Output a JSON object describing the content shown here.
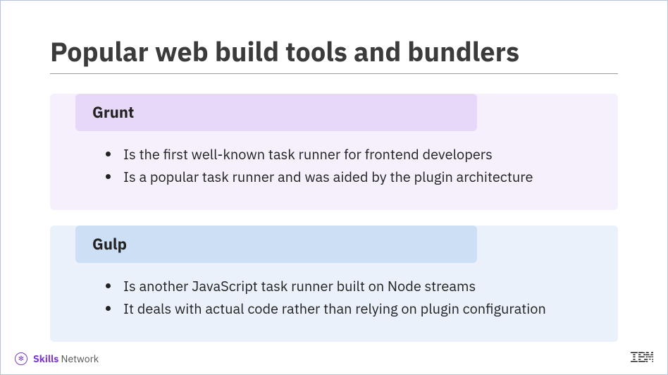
{
  "title": "Popular web build tools and bundlers",
  "sections": [
    {
      "heading": "Grunt",
      "bullets": [
        "Is the first well-known task runner for frontend developers",
        "Is a popular task runner and was aided by the plugin architecture"
      ]
    },
    {
      "heading": "Gulp",
      "bullets": [
        "Is another JavaScript task runner built on Node streams",
        "It deals with actual code rather than relying on plugin configuration"
      ]
    }
  ],
  "footer": {
    "skills_bold": "Skills",
    "skills_rest": " Network",
    "logo": "IBM"
  }
}
